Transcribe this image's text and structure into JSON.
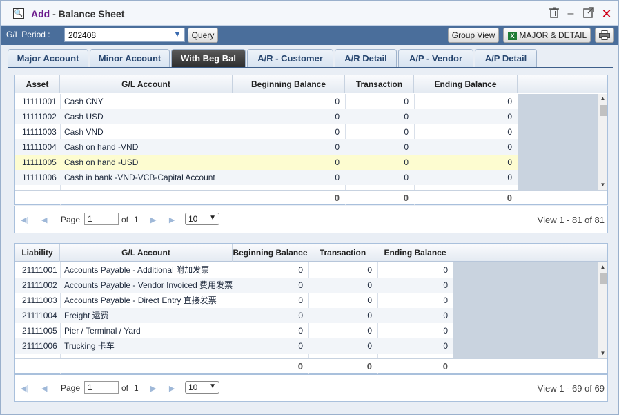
{
  "window": {
    "title_prefix": "Add",
    "title_sep": " - ",
    "title": "Balance Sheet"
  },
  "toolbar": {
    "gl_label": "G/L Period :",
    "period_value": "202408",
    "query_label": "Query",
    "group_view_label": "Group View",
    "major_detail_label": "MAJOR & DETAIL"
  },
  "tabs": [
    {
      "label": "Major Account"
    },
    {
      "label": "Minor Account"
    },
    {
      "label": "With Beg Bal"
    },
    {
      "label": "A/R - Customer"
    },
    {
      "label": "A/R Detail"
    },
    {
      "label": "A/P - Vendor"
    },
    {
      "label": "A/P Detail"
    }
  ],
  "asset_grid": {
    "headers": [
      "Asset",
      "G/L Account",
      "Beginning Balance",
      "Transaction",
      "Ending Balance"
    ],
    "rows": [
      {
        "acct": "11111001",
        "name": "Cash CNY",
        "beg": "0",
        "trans": "0",
        "end": "0"
      },
      {
        "acct": "11111002",
        "name": "Cash USD",
        "beg": "0",
        "trans": "0",
        "end": "0"
      },
      {
        "acct": "11111003",
        "name": "Cash VND",
        "beg": "0",
        "trans": "0",
        "end": "0"
      },
      {
        "acct": "11111004",
        "name": "Cash on hand -VND",
        "beg": "0",
        "trans": "0",
        "end": "0"
      },
      {
        "acct": "11111005",
        "name": "Cash on hand -USD",
        "beg": "0",
        "trans": "0",
        "end": "0"
      },
      {
        "acct": "11111006",
        "name": "Cash in bank -VND-VCB-Capital Account",
        "beg": "0",
        "trans": "0",
        "end": "0"
      }
    ],
    "totals": {
      "beg": "0",
      "trans": "0",
      "end": "0"
    },
    "pager": {
      "page_label": "Page",
      "page_value": "1",
      "of_label": "of",
      "total_pages": "1",
      "rows_per_page": "10",
      "view_text": "View 1 - 81 of 81"
    }
  },
  "liability_grid": {
    "headers": [
      "Liability",
      "G/L Account",
      "Beginning Balance",
      "Transaction",
      "Ending Balance"
    ],
    "rows": [
      {
        "acct": "21111001",
        "name": "Accounts Payable - Additional 附加发票",
        "beg": "0",
        "trans": "0",
        "end": "0"
      },
      {
        "acct": "21111002",
        "name": "Accounts Payable - Vendor Invoiced 费用发票",
        "beg": "0",
        "trans": "0",
        "end": "0"
      },
      {
        "acct": "21111003",
        "name": "Accounts Payable - Direct Entry 直接发票",
        "beg": "0",
        "trans": "0",
        "end": "0"
      },
      {
        "acct": "21111004",
        "name": "Freight 运费",
        "beg": "0",
        "trans": "0",
        "end": "0"
      },
      {
        "acct": "21111005",
        "name": "Pier / Terminal / Yard",
        "beg": "0",
        "trans": "0",
        "end": "0"
      },
      {
        "acct": "21111006",
        "name": "Trucking 卡车",
        "beg": "0",
        "trans": "0",
        "end": "0"
      }
    ],
    "totals": {
      "beg": "0",
      "trans": "0",
      "end": "0"
    },
    "pager": {
      "page_label": "Page",
      "page_value": "1",
      "of_label": "of",
      "total_pages": "1",
      "rows_per_page": "10",
      "view_text": "View 1 - 69 of 69"
    }
  },
  "icons": {
    "window": "magnifier-icon",
    "delete": "trash-icon",
    "minimize": "minimize-icon",
    "maximize": "maximize-icon",
    "close": "close-icon",
    "excel": "excel-icon",
    "print": "printer-icon"
  },
  "colors": {
    "toolbar": "#4a6e9b",
    "active_tab": "#2d2d2d",
    "selected_row": "#fdfcd0",
    "title_accent": "#6b1a8c",
    "close": "#d0021b"
  }
}
